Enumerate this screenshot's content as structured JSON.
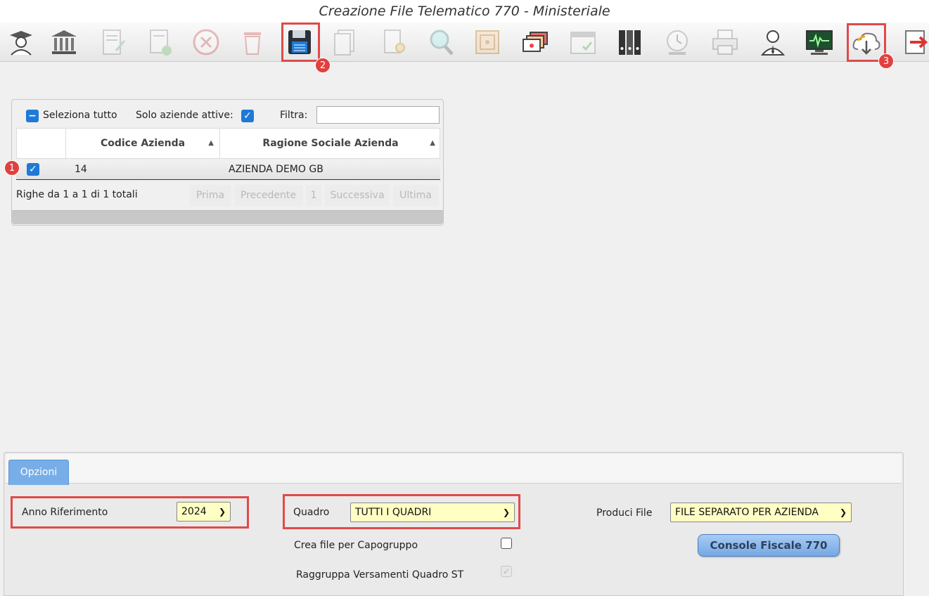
{
  "window": {
    "title": "Creazione File Telematico 770 - Ministeriale"
  },
  "toolbar": {
    "icons": [
      {
        "name": "user-graduate-icon",
        "enabled": true
      },
      {
        "name": "bank-icon",
        "enabled": true
      },
      {
        "name": "document-edit-icon",
        "enabled": false
      },
      {
        "name": "document-add-icon",
        "enabled": false
      },
      {
        "name": "cancel-icon",
        "enabled": false
      },
      {
        "name": "trash-icon",
        "enabled": false
      },
      {
        "name": "save-disk-icon",
        "enabled": true
      },
      {
        "name": "documents-icon",
        "enabled": false
      },
      {
        "name": "document-search-icon",
        "enabled": false
      },
      {
        "name": "magnifier-icon",
        "enabled": false
      },
      {
        "name": "safe-icon",
        "enabled": false
      },
      {
        "name": "screens-icon",
        "enabled": true
      },
      {
        "name": "calendar-check-icon",
        "enabled": false
      },
      {
        "name": "binders-icon",
        "enabled": true
      },
      {
        "name": "clock-icon",
        "enabled": false
      },
      {
        "name": "printer-icon",
        "enabled": false
      },
      {
        "name": "user-tie-icon",
        "enabled": true
      },
      {
        "name": "monitor-chart-icon",
        "enabled": true
      },
      {
        "name": "cloud-download-icon",
        "enabled": true
      },
      {
        "name": "exit-icon",
        "enabled": true
      }
    ]
  },
  "annotations": {
    "m1": "1",
    "m2": "2",
    "m3": "3"
  },
  "grid": {
    "select_all_label": "Seleziona tutto",
    "active_only_label": "Solo aziende attive:",
    "filter_label": "Filtra:",
    "filter_value": "",
    "columns": [
      "Codice Azienda",
      "Ragione Sociale Azienda"
    ],
    "rows": [
      {
        "checked": true,
        "code": "14",
        "name": "AZIENDA DEMO GB"
      }
    ],
    "rows_info": "Righe da 1 a 1 di 1 totali",
    "pager": {
      "first": "Prima",
      "prev": "Precedente",
      "page": "1",
      "next": "Successiva",
      "last": "Ultima"
    }
  },
  "options": {
    "tab_label": "Opzioni",
    "anno_label": "Anno Riferimento",
    "anno_value": "2024",
    "quadro_label": "Quadro",
    "quadro_value": "TUTTI I QUADRI",
    "produci_label": "Produci File",
    "produci_value": "FILE SEPARATO PER AZIENDA",
    "capogruppo_label": "Crea file per Capogruppo",
    "raggruppa_label": "Raggruppa Versamenti Quadro ST",
    "console_button": "Console Fiscale 770"
  }
}
